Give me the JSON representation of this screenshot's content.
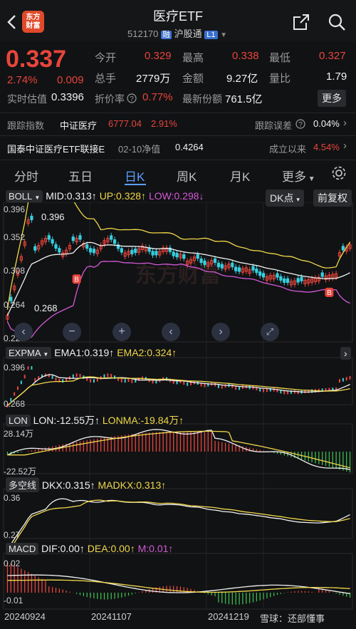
{
  "header": {
    "logo_line1": "东方",
    "logo_line2": "财富",
    "title": "医疗ETF",
    "code": "512170",
    "badge_rong": "融",
    "badge_market": "沪股通",
    "badge_level": "L1"
  },
  "quote": {
    "price": "0.337",
    "change_pct": "2.74%",
    "change_abs": "0.009",
    "open_label": "今开",
    "open": "0.329",
    "high_label": "最高",
    "high": "0.338",
    "low_label": "最低",
    "low": "0.327",
    "vol_label": "总手",
    "vol": "2779万",
    "amount_label": "金额",
    "amount": "9.27亿",
    "ratio_label": "量比",
    "ratio": "1.79",
    "iopv_label": "实时估值",
    "iopv": "0.3396",
    "discount_label": "折价率",
    "discount": "0.77%",
    "shares_label": "最新份额",
    "shares": "761.5亿",
    "more": "更多"
  },
  "tracking": {
    "index_label": "跟踪指数",
    "index_name": "中证医疗",
    "index_value": "6777.04",
    "index_pct": "2.91%",
    "error_label": "跟踪误差",
    "error_value": "0.04%"
  },
  "linked_fund": {
    "name": "国泰中证医疗ETF联接E",
    "nav_label": "02-10净值",
    "nav": "0.4264",
    "since_label": "成立以来",
    "since": "4.54%"
  },
  "tabs": [
    "分时",
    "五日",
    "日K",
    "周K",
    "月K",
    "更多"
  ],
  "tab_active": "日K",
  "boll": {
    "name": "BOLL",
    "mid": "MID:0.313↑",
    "up": "UP:0.328↑",
    "low": "LOW:0.298↓",
    "dk_button": "DK点",
    "fq_button": "前复权",
    "y_ticks": [
      "0.396",
      "0.352",
      "0.308",
      "0.264",
      "0.220"
    ],
    "marker_high": "0.396",
    "marker_low": "0.268",
    "b_marker": "B",
    "watermark": "东方财富"
  },
  "expma": {
    "name": "EXPMA",
    "ema1": "EMA1:0.319↑",
    "ema2": "EMA2:0.324↑",
    "y_top": "0.396",
    "y_bottom": "0.268"
  },
  "lon": {
    "name": "LON",
    "lon": "LON:-12.55万↑",
    "lonma": "LONMA:-19.84万↑",
    "y_top": "28.14万",
    "y_bottom": "-22.52万"
  },
  "dkx": {
    "name": "多空线",
    "dkx": "DKX:0.315↑",
    "madkx": "MADKX:0.313↑",
    "y_top": "0.36",
    "y_bottom": "0.27"
  },
  "macd": {
    "name": "MACD",
    "dif": "DIF:0.00↑",
    "dea": "DEA:0.00↑",
    "m": "M:0.01↑",
    "y_top": "0.02",
    "y_bottom": "-0.01"
  },
  "dates": [
    "20240924",
    "20241107",
    "20241219"
  ],
  "footer_watermark": "雪球：还部懂事",
  "colors": {
    "up": "#e8453c",
    "down": "#3dbb4e",
    "accent": "#5aa0ff",
    "mid": "#f2f2f2",
    "upper": "#f0d84a",
    "lower": "#d45ad8",
    "ema_cyan": "#35d0e0"
  }
}
